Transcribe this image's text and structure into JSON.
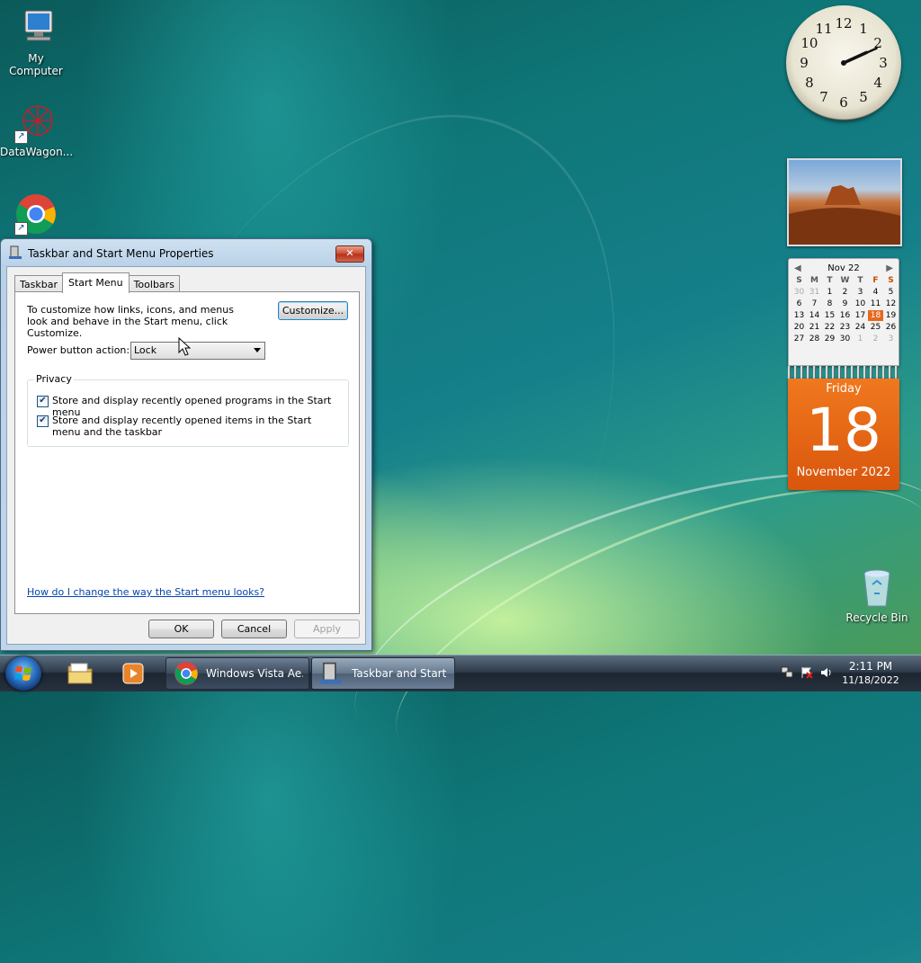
{
  "desktop": {
    "icons": [
      {
        "label": "My Computer"
      },
      {
        "label": "DataWagon..."
      },
      {
        "label": ""
      },
      {
        "label": "Recycle Bin"
      }
    ]
  },
  "clock": {
    "numbers": [
      "12",
      "1",
      "2",
      "3",
      "4",
      "5",
      "6",
      "7",
      "8",
      "9",
      "10",
      "11"
    ],
    "time_hours": 2,
    "time_minutes": 11
  },
  "calendar": {
    "month_title": "Nov 22",
    "prev": "◀",
    "next": "▶",
    "dow": [
      "S",
      "M",
      "T",
      "W",
      "T",
      "F",
      "S"
    ],
    "days": [
      "30",
      "31",
      "1",
      "2",
      "3",
      "4",
      "5",
      "6",
      "7",
      "8",
      "9",
      "10",
      "11",
      "12",
      "13",
      "14",
      "15",
      "16",
      "17",
      "18",
      "19",
      "20",
      "21",
      "22",
      "23",
      "24",
      "25",
      "26",
      "27",
      "28",
      "29",
      "30",
      "1",
      "2",
      "3"
    ],
    "day_name": "Friday",
    "day_number": "18",
    "month_year": "November 2022"
  },
  "dialog": {
    "title": "Taskbar and Start Menu Properties",
    "close": "✕",
    "tabs": [
      "Taskbar",
      "Start Menu",
      "Toolbars"
    ],
    "description": "To customize how links, icons, and menus look and behave in the Start menu, click Customize.",
    "customize_label": "Customize...",
    "power_label": "Power button action:",
    "power_value": "Lock",
    "privacy_title": "Privacy",
    "privacy_items": [
      "Store and display recently opened programs in the Start menu",
      "Store and display recently opened items in the Start menu and the taskbar"
    ],
    "check_glyph": "✔",
    "help_link": "How do I change the way the Start menu looks?",
    "ok_label": "OK",
    "cancel_label": "Cancel",
    "apply_label": "Apply"
  },
  "taskbar": {
    "buttons": [
      "Windows Vista Ae...",
      "Taskbar and Start ..."
    ],
    "time": "2:11 PM",
    "date": "11/18/2022",
    "tray_icons": [
      "network-icon",
      "flag-icon",
      "volume-icon"
    ]
  }
}
